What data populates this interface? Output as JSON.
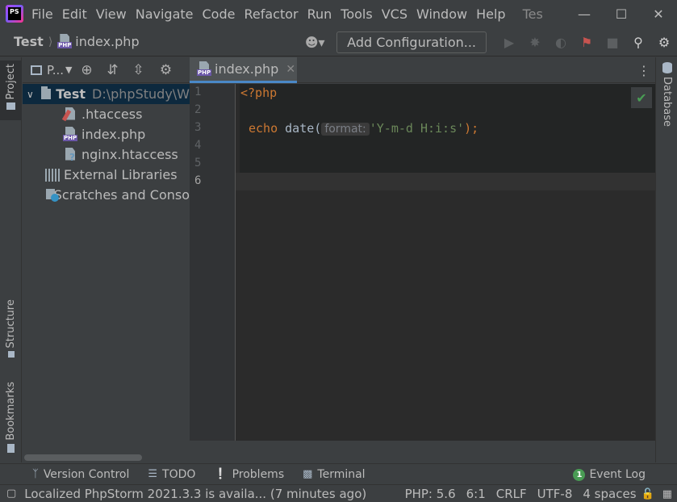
{
  "menubar": {
    "logo_label": "PS",
    "items": [
      "File",
      "Edit",
      "View",
      "Navigate",
      "Code",
      "Refactor",
      "Run",
      "Tools",
      "VCS",
      "Window",
      "Help"
    ],
    "title": "Tes"
  },
  "navbar": {
    "project": "Test",
    "file": "index.php",
    "add_configuration": "Add Configuration..."
  },
  "left_strip": {
    "project_tab": "Project",
    "structure_tab": "Structure",
    "bookmarks_tab": "Bookmarks"
  },
  "project_panel": {
    "title": "P...",
    "tree": {
      "root": {
        "name": "Test",
        "path": "D:\\phpStudy\\W"
      },
      "files": [
        ".htaccess",
        "index.php",
        "nginx.htaccess"
      ],
      "external_libraries": "External Libraries",
      "scratches": "Scratches and Conso"
    }
  },
  "editor": {
    "tab_name": "index.php",
    "line_numbers": [
      "1",
      "2",
      "3",
      "4",
      "5",
      "6"
    ],
    "line1": "<?php",
    "line3_kw": "echo",
    "line3_fn": "date(",
    "line3_hint": "format:",
    "line3_str": "'Y-m-d H:i:s'",
    "line3_end": ");"
  },
  "right_strip": {
    "database_tab": "Database"
  },
  "tool_windows": {
    "version_control": "Version Control",
    "todo": "TODO",
    "problems": "Problems",
    "terminal": "Terminal",
    "event_log": "Event Log",
    "event_count": "1"
  },
  "statusbar": {
    "message": "Localized PhpStorm 2021.3.3 is availa... (7 minutes ago)",
    "php_version": "PHP: 5.6",
    "position": "6:1",
    "line_ending": "CRLF",
    "encoding": "UTF-8",
    "indent": "4 spaces"
  }
}
